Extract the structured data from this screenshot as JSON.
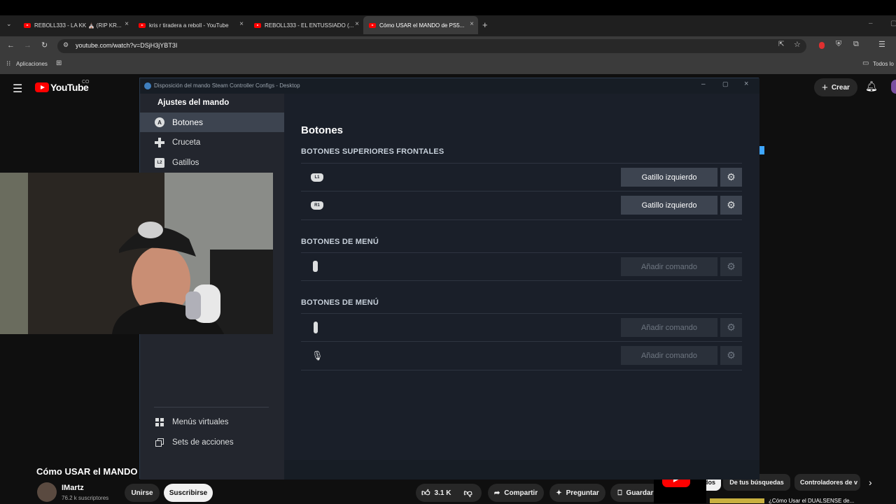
{
  "browser": {
    "tabs": [
      {
        "title": "REBOLL333 - LA KK ⛪ (RIP KR...",
        "active": false
      },
      {
        "title": "kris r tiradera a reboll - YouTube",
        "active": false
      },
      {
        "title": "REBOLL333 - EL ENTUSSIADO (...",
        "active": false
      },
      {
        "title": "Cómo USAR el MANDO de PS5...",
        "active": true
      }
    ],
    "url": "youtube.com/watch?v=DSjH3jYBT3I",
    "bookmarks": {
      "apps_label": "Aplicaciones",
      "all_label": "Todos lo"
    }
  },
  "youtube": {
    "logo_text": "YouTube",
    "country": "CO",
    "create_label": "Crear",
    "video_title": "Cómo USAR el MANDO",
    "channel_name": "IMartz",
    "subscribers": "76.2 k suscriptores",
    "join_label": "Unirse",
    "subscribe_label": "Suscribirse",
    "likes": "3.1 K",
    "share_label": "Compartir",
    "ask_label": "Preguntar",
    "save_label": "Guardar",
    "chips": [
      "dos",
      "De tus búsquedas",
      "Controladores de v"
    ],
    "next_video_title": "¿Cómo Usar el DUALSENSE de..."
  },
  "steam": {
    "window_title": "Disposición del mando Steam Controller Configs - Desktop",
    "sidebar_header": "Ajustes del mando",
    "sidebar_items": [
      {
        "label": "Botones",
        "icon": "a-button-icon",
        "active": true
      },
      {
        "label": "Cruceta",
        "icon": "dpad-icon",
        "active": false
      },
      {
        "label": "Gatillos",
        "icon": "l2-trigger-icon",
        "active": false
      }
    ],
    "sidebar_bottom": [
      {
        "label": "Menús virtuales",
        "icon": "grid-icon"
      },
      {
        "label": "Sets de acciones",
        "icon": "layers-icon"
      }
    ],
    "main_title": "Botones",
    "sections": [
      {
        "heading": "BOTONES SUPERIORES FRONTALES",
        "rows": [
          {
            "badge": "L1",
            "icon": "l1-bumper-icon",
            "command": "Gatillo izquierdo",
            "enabled": true
          },
          {
            "badge": "R1",
            "icon": "r1-bumper-icon",
            "command": "Gatillo izquierdo",
            "enabled": true
          }
        ]
      },
      {
        "heading": "BOTONES DE MENÚ",
        "rows": [
          {
            "badge": "",
            "icon": "touchpad-click-icon",
            "command": "Añadir comando",
            "enabled": false
          }
        ]
      },
      {
        "heading": "BOTONES DE MENÚ",
        "rows": [
          {
            "badge": "",
            "icon": "create-button-icon",
            "command": "Añadir comando",
            "enabled": false
          },
          {
            "badge": "",
            "icon": "mic-mute-icon",
            "command": "Añadir comando",
            "enabled": false
          }
        ]
      }
    ]
  }
}
